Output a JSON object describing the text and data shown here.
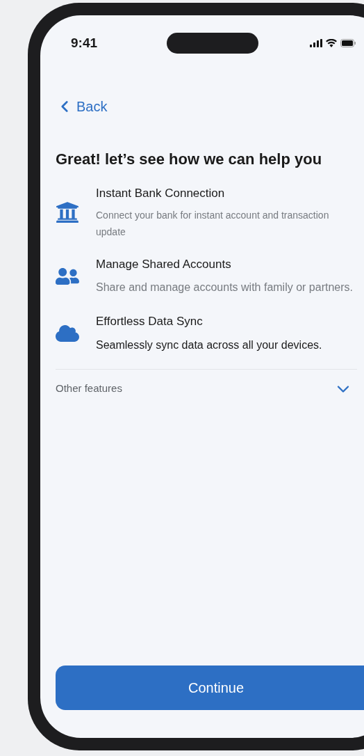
{
  "status_bar": {
    "time": "9:41"
  },
  "nav": {
    "back": "Back"
  },
  "title": "Great! let’s see how we can help you",
  "features": [
    {
      "title": "Instant Bank Connection",
      "description": "Connect your bank for instant account and transaction update",
      "muted": true
    },
    {
      "title": "Manage Shared Accounts",
      "description": "Share and manage accounts with family or partners.",
      "muted": true
    },
    {
      "title": "Effortless Data Sync",
      "description": "Seamlessly sync data across all your devices.",
      "muted": false
    }
  ],
  "other_features": {
    "label": "Other features",
    "expanded": false
  },
  "continue_button": "Continue"
}
